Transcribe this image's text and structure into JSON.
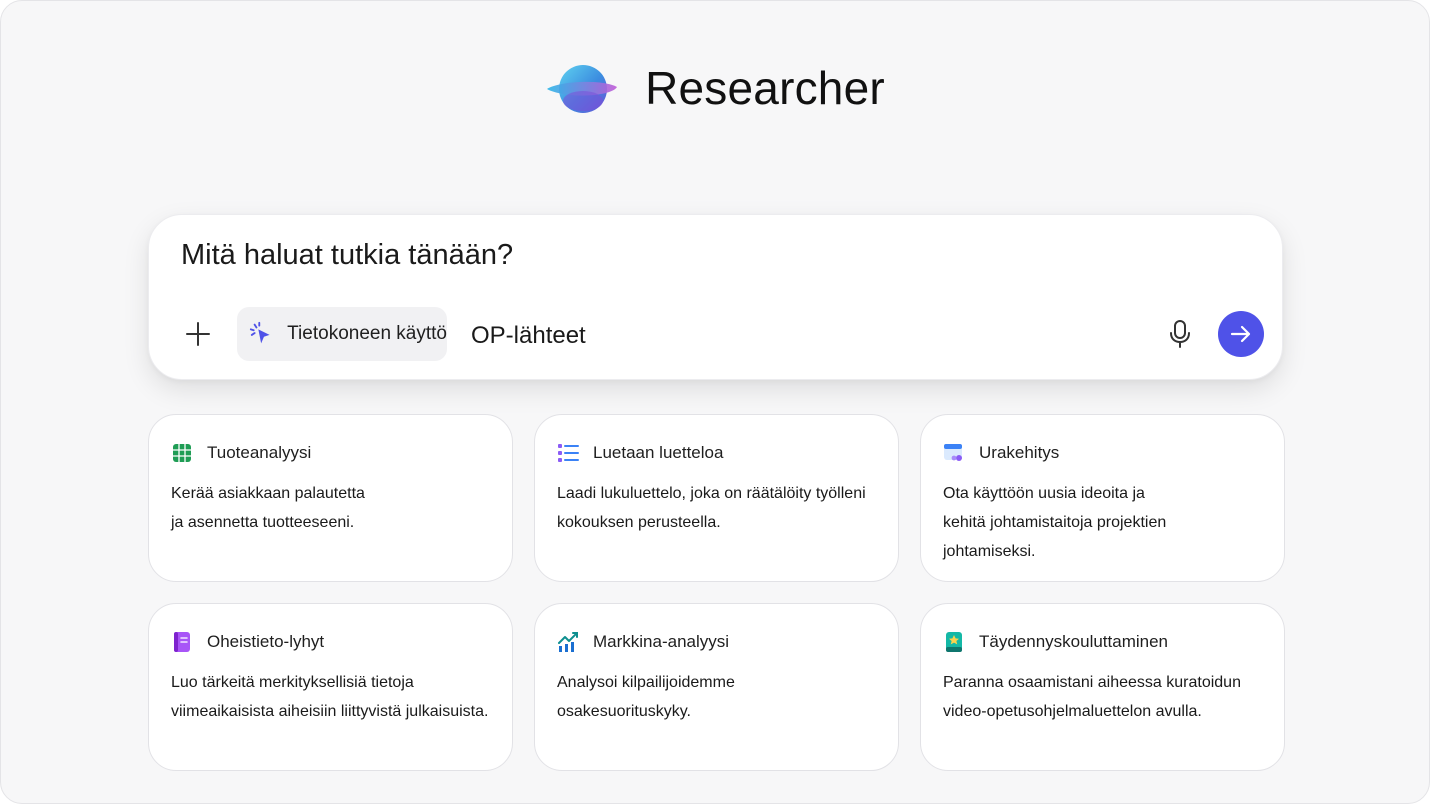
{
  "header": {
    "title": "Researcher",
    "logo_icon": "researcher-logo-icon"
  },
  "prompt": {
    "placeholder": "Mitä haluat tutkia tänään?",
    "tool_chip_label": "Tietokoneen käyttö",
    "sources_label": "OP-lähteet"
  },
  "colors": {
    "accent": "#4f52e8",
    "background": "#f7f7f8"
  },
  "cards": [
    {
      "title": "Tuoteanalyysi",
      "icon": "spreadsheet-icon",
      "line1": "Kerää asiakkaan palautetta",
      "line2": "ja asennetta tuotteeseeni."
    },
    {
      "title": "Luetaan luetteloa",
      "icon": "list-icon",
      "line1": "Laadi lukuluettelo, joka on räätälöity työlleni",
      "line2": "kokouksen perusteella."
    },
    {
      "title": "Urakehitys",
      "icon": "calendar-people-icon",
      "line1": "Ota käyttöön uusia ideoita ja",
      "line2": "kehitä johtamistaitoja projektien johtamiseksi."
    },
    {
      "title": "Oheistieto-lyhyt",
      "icon": "notebook-icon",
      "line1": "Luo tärkeitä merkityksellisiä tietoja",
      "line2": "viimeaikaisista aiheisiin liittyvistä julkaisuista."
    },
    {
      "title": "Markkina-analyysi",
      "icon": "trend-chart-icon",
      "line1": "Analysoi kilpailijoidemme",
      "line2": "osakesuorituskyky."
    },
    {
      "title": "Täydennyskouluttaminen",
      "icon": "book-star-icon",
      "line1": "Paranna osaamistani aiheessa kuratoidun",
      "line2": "video-opetusohjelmaluettelon avulla."
    }
  ]
}
